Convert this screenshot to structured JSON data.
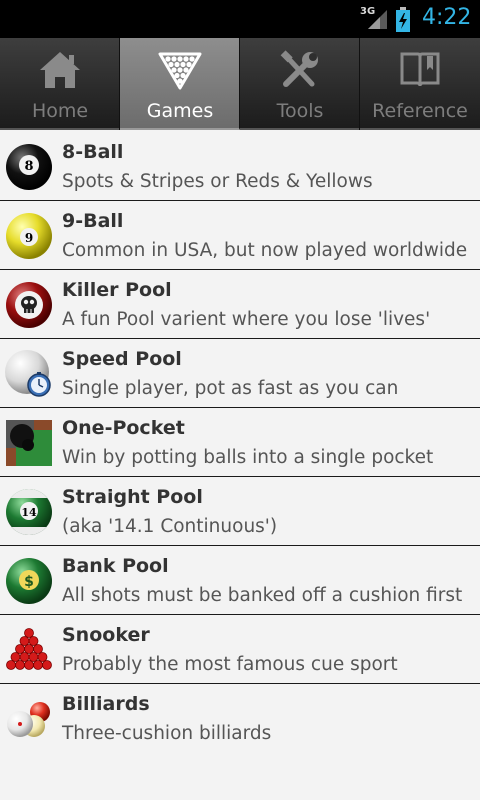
{
  "status_bar": {
    "network": "3G",
    "time": "4:22",
    "time_color": "#33b5e5",
    "icons": [
      "signal-icon",
      "battery-charging-icon"
    ]
  },
  "tabs": [
    {
      "label": "Home",
      "icon": "home-icon",
      "active": false
    },
    {
      "label": "Games",
      "icon": "ball-rack-icon",
      "active": true
    },
    {
      "label": "Tools",
      "icon": "tools-icon",
      "active": false
    },
    {
      "label": "Reference",
      "icon": "book-icon",
      "active": false
    }
  ],
  "games": [
    {
      "title": "8-Ball",
      "subtitle": "Spots & Stripes or Reds & Yellows",
      "icon": "eight-ball-icon"
    },
    {
      "title": "9-Ball",
      "subtitle": "Common in USA, but now played worldwide",
      "icon": "nine-ball-icon"
    },
    {
      "title": "Killer Pool",
      "subtitle": "A fun Pool varient where you lose 'lives'",
      "icon": "skull-ball-icon"
    },
    {
      "title": "Speed Pool",
      "subtitle": "Single player, pot as fast as you can",
      "icon": "stopwatch-ball-icon"
    },
    {
      "title": "One-Pocket",
      "subtitle": "Win by potting balls into a single pocket",
      "icon": "pocket-icon"
    },
    {
      "title": "Straight Pool",
      "subtitle": "(aka '14.1 Continuous')",
      "icon": "fourteen-ball-icon"
    },
    {
      "title": "Bank Pool",
      "subtitle": "All shots must be banked off a cushion first",
      "icon": "dollar-ball-icon"
    },
    {
      "title": "Snooker",
      "subtitle": "Probably the most famous cue sport",
      "icon": "snooker-rack-icon"
    },
    {
      "title": "Billiards",
      "subtitle": "Three-cushion billiards",
      "icon": "billiard-balls-icon"
    }
  ]
}
